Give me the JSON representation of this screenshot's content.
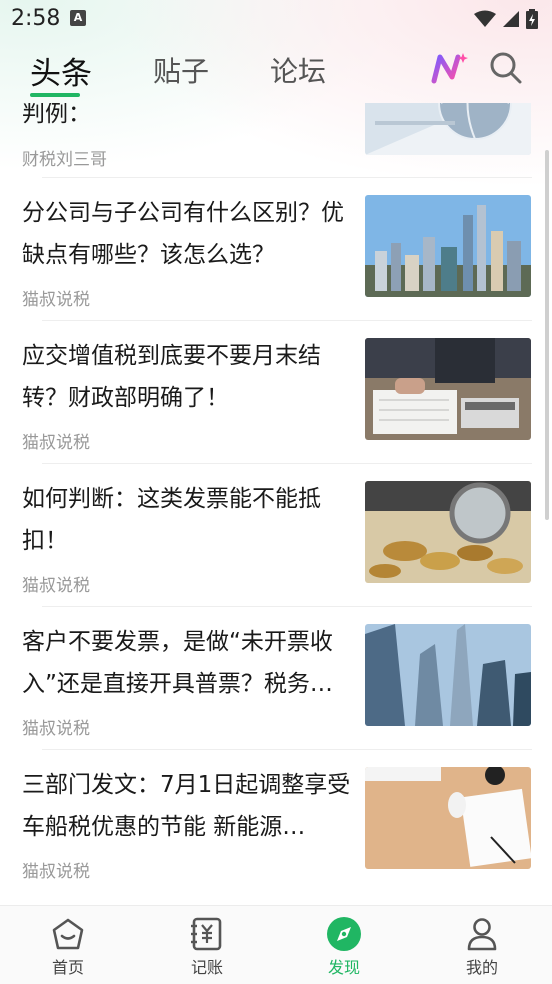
{
  "status": {
    "time": "2:58",
    "notif_letter": "A"
  },
  "tabs": [
    {
      "label": "头条",
      "active": true
    },
    {
      "label": "贴子",
      "active": false
    },
    {
      "label": "论坛",
      "active": false
    }
  ],
  "top_icons": {
    "ai": "ai-sparkle-icon",
    "search": "search-icon"
  },
  "feed": [
    {
      "title": "判例：",
      "source": "财税刘三哥",
      "thumb": "globe-documents-image"
    },
    {
      "title": "分公司与子公司有什么区别？优缺点有哪些？该怎么选？",
      "source": "猫叔说税",
      "thumb": "city-skyline-image"
    },
    {
      "title": "应交增值税到底要不要月末结转？财政部明确了！",
      "source": "猫叔说税",
      "thumb": "calculator-documents-image"
    },
    {
      "title": "如何判断：这类发票能不能抵扣！",
      "source": "猫叔说税",
      "thumb": "magnifier-coins-image"
    },
    {
      "title": "客户不要发票，是做“未开票收入”还是直接开具普票？税务…",
      "source": "猫叔说税",
      "thumb": "skyscrapers-image"
    },
    {
      "title": "三部门发文：7月1日起调整享受车船税优惠的节能 新能源…",
      "source": "猫叔说税",
      "thumb": "desk-notebook-image"
    }
  ],
  "bottom_nav": [
    {
      "label": "首页",
      "icon": "home-icon",
      "active": false
    },
    {
      "label": "记账",
      "icon": "ledger-yen-icon",
      "active": false
    },
    {
      "label": "发现",
      "icon": "compass-icon",
      "active": true
    },
    {
      "label": "我的",
      "icon": "profile-icon",
      "active": false
    }
  ],
  "colors": {
    "accent": "#20b663",
    "ai_gradient_start": "#7b5cff",
    "ai_gradient_end": "#ff4fa8"
  }
}
